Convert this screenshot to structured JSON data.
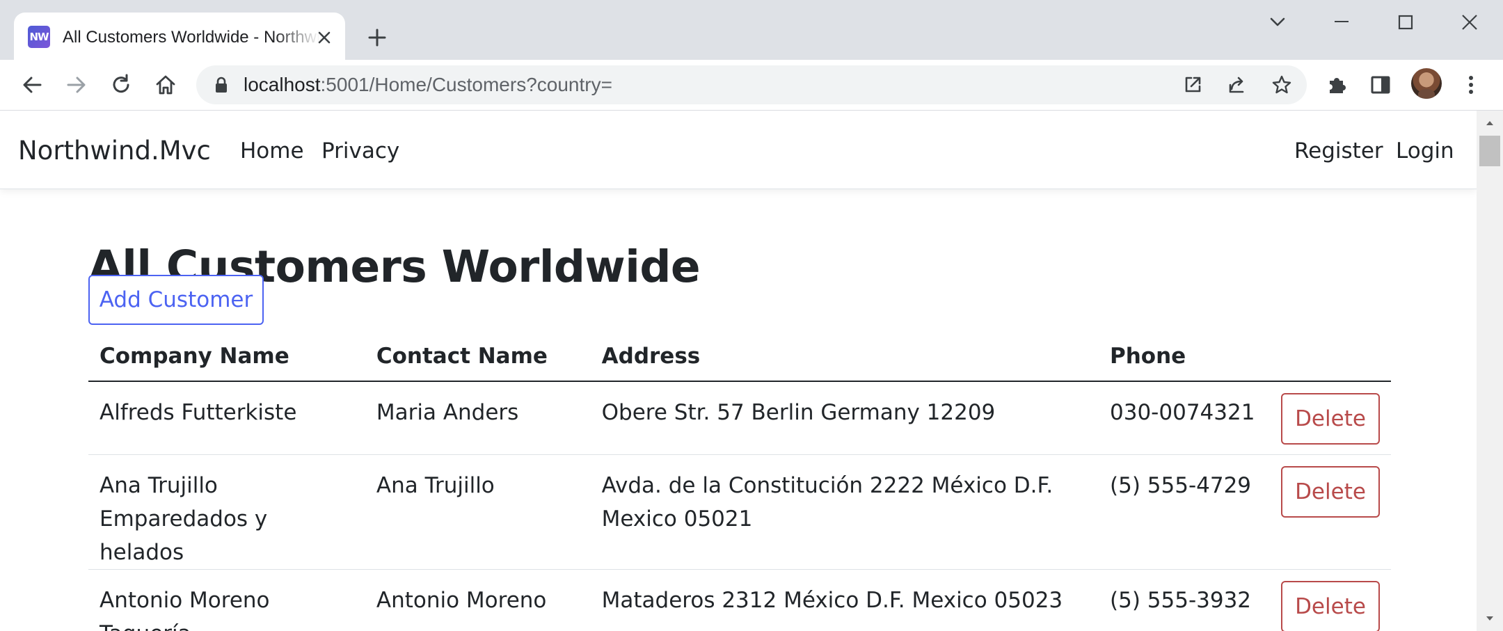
{
  "browser": {
    "tab_title": "All Customers Worldwide - Northwind.Mvc",
    "favicon_text": "NW",
    "url_host": "localhost",
    "url_rest": ":5001/Home/Customers?country="
  },
  "site": {
    "brand": "Northwind.Mvc",
    "nav": {
      "home": "Home",
      "privacy": "Privacy",
      "register": "Register",
      "login": "Login"
    }
  },
  "page": {
    "title": "All Customers Worldwide",
    "add_button": "Add Customer"
  },
  "table": {
    "headers": {
      "company": "Company Name",
      "contact": "Contact Name",
      "address": "Address",
      "phone": "Phone"
    },
    "rows": [
      {
        "company": "Alfreds Futterkiste",
        "contact": "Maria Anders",
        "address": "Obere Str. 57 Berlin Germany 12209",
        "phone": "030-0074321",
        "delete_label": "Delete"
      },
      {
        "company": "Ana Trujillo Emparedados y helados",
        "contact": "Ana Trujillo",
        "address": "Avda. de la Constitución 2222 México D.F. Mexico 05021",
        "phone": "(5) 555-4729",
        "delete_label": "Delete"
      },
      {
        "company": "Antonio Moreno Taquería",
        "contact": "Antonio Moreno",
        "address": "Mataderos 2312 México D.F. Mexico 05023",
        "phone": "(5) 555-3932",
        "delete_label": "Delete"
      }
    ]
  },
  "colors": {
    "primary_outline": "#4c63f2",
    "danger_outline": "#b84a4a",
    "tab_strip": "#dee1e6"
  }
}
